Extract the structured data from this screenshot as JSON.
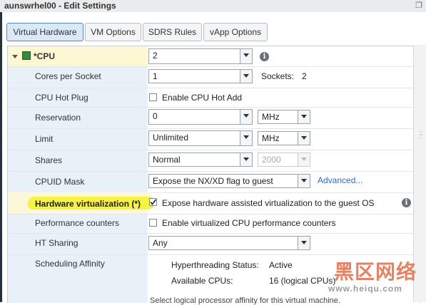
{
  "window": {
    "title": "aunswrhel00 - Edit Settings"
  },
  "tabs": [
    {
      "label": "Virtual Hardware",
      "active": true
    },
    {
      "label": "VM Options",
      "active": false
    },
    {
      "label": "SDRS Rules",
      "active": false
    },
    {
      "label": "vApp Options",
      "active": false
    }
  ],
  "cpu": {
    "label": "*CPU",
    "value": "2"
  },
  "cores_per_socket": {
    "label": "Cores per Socket",
    "value": "1",
    "sockets_label": "Sockets:",
    "sockets_value": "2"
  },
  "cpu_hot_plug": {
    "label": "CPU Hot Plug",
    "checkbox_label": "Enable CPU Hot Add",
    "checked": false
  },
  "reservation": {
    "label": "Reservation",
    "value": "0",
    "unit": "MHz"
  },
  "limit": {
    "label": "Limit",
    "value": "Unlimited",
    "unit": "MHz"
  },
  "shares": {
    "label": "Shares",
    "value": "Normal",
    "amount": "2000"
  },
  "cpuid_mask": {
    "label": "CPUID Mask",
    "value": "Expose the NX/XD flag to guest",
    "advanced_link": "Advanced..."
  },
  "hardware_virtualization": {
    "label": "Hardware virtualization (*)",
    "checkbox_label": "Expose hardware assisted virtualization to the guest OS",
    "checked": true
  },
  "performance_counters": {
    "label": "Performance counters",
    "checkbox_label": "Enable virtualized CPU performance counters",
    "checked": false
  },
  "ht_sharing": {
    "label": "HT Sharing",
    "value": "Any"
  },
  "scheduling_affinity": {
    "label": "Scheduling Affinity",
    "hyperthreading_label": "Hyperthreading Status:",
    "hyperthreading_value": "Active",
    "available_label": "Available CPUs:",
    "available_value": "16 (logical CPUs)",
    "description": "Select logical processor affinity for this virtual machine."
  },
  "watermark": {
    "text": "黑区网络",
    "url": "www.heiqu.com"
  },
  "colors": {
    "highlight": "#f4f22a",
    "tab_active": "#dbe8f6",
    "label_column": "#e8f0f8",
    "link": "#2a6ebb"
  }
}
